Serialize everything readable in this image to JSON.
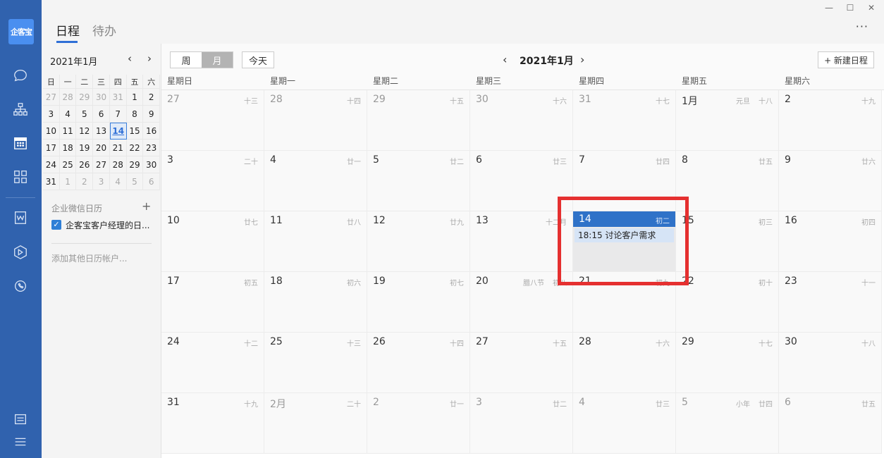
{
  "app": {
    "logo": "企客宝"
  },
  "tabs": {
    "schedule": "日程",
    "todo": "待办"
  },
  "window": {
    "minimize": "—",
    "maximize": "☐",
    "close": "✕",
    "more": "···"
  },
  "mini": {
    "title": "2021年1月",
    "prev": "‹",
    "next": "›",
    "weekdays": [
      "日",
      "一",
      "二",
      "三",
      "四",
      "五",
      "六"
    ],
    "weeks": [
      [
        "27",
        "28",
        "29",
        "30",
        "31",
        "1",
        "2"
      ],
      [
        "3",
        "4",
        "5",
        "6",
        "7",
        "8",
        "9"
      ],
      [
        "10",
        "11",
        "12",
        "13",
        "14",
        "15",
        "16"
      ],
      [
        "17",
        "18",
        "19",
        "20",
        "21",
        "22",
        "23"
      ],
      [
        "24",
        "25",
        "26",
        "27",
        "28",
        "29",
        "30"
      ],
      [
        "31",
        "1",
        "2",
        "3",
        "4",
        "5",
        "6"
      ]
    ],
    "section_label": "企业微信日历",
    "section_add": "+",
    "calendar_name": "企客宝客户经理的日...",
    "add_account": "添加其他日历帐户..."
  },
  "toolbar": {
    "week": "周",
    "month": "月",
    "today": "今天",
    "prev": "‹",
    "title": "2021年1月",
    "next": "›",
    "new_event": "+ 新建日程"
  },
  "weekdays": [
    "星期日",
    "星期一",
    "星期二",
    "星期三",
    "星期四",
    "星期五",
    "星期六"
  ],
  "month_grid": [
    [
      {
        "d": "27",
        "l": "十三",
        "o": 1
      },
      {
        "d": "28",
        "l": "十四",
        "o": 1
      },
      {
        "d": "29",
        "l": "十五",
        "o": 1
      },
      {
        "d": "30",
        "l": "十六",
        "o": 1
      },
      {
        "d": "31",
        "l": "十七",
        "o": 1
      },
      {
        "d": "1月",
        "l": "十八",
        "f": "元旦"
      },
      {
        "d": "2",
        "l": "十九"
      }
    ],
    [
      {
        "d": "3",
        "l": "二十"
      },
      {
        "d": "4",
        "l": "廿一"
      },
      {
        "d": "5",
        "l": "廿二"
      },
      {
        "d": "6",
        "l": "廿三"
      },
      {
        "d": "7",
        "l": "廿四"
      },
      {
        "d": "8",
        "l": "廿五"
      },
      {
        "d": "9",
        "l": "廿六"
      }
    ],
    [
      {
        "d": "10",
        "l": "廿七"
      },
      {
        "d": "11",
        "l": "廿八"
      },
      {
        "d": "12",
        "l": "廿九"
      },
      {
        "d": "13",
        "l": "十二月"
      },
      {
        "d": "14",
        "l": "初二",
        "sel": 1
      },
      {
        "d": "15",
        "l": "初三"
      },
      {
        "d": "16",
        "l": "初四"
      }
    ],
    [
      {
        "d": "17",
        "l": "初五"
      },
      {
        "d": "18",
        "l": "初六"
      },
      {
        "d": "19",
        "l": "初七"
      },
      {
        "d": "20",
        "l": "初八",
        "f": "腊八节"
      },
      {
        "d": "21",
        "l": "初九"
      },
      {
        "d": "22",
        "l": "初十"
      },
      {
        "d": "23",
        "l": "十一"
      }
    ],
    [
      {
        "d": "24",
        "l": "十二"
      },
      {
        "d": "25",
        "l": "十三"
      },
      {
        "d": "26",
        "l": "十四"
      },
      {
        "d": "27",
        "l": "十五"
      },
      {
        "d": "28",
        "l": "十六"
      },
      {
        "d": "29",
        "l": "十七"
      },
      {
        "d": "30",
        "l": "十八"
      }
    ],
    [
      {
        "d": "31",
        "l": "十九"
      },
      {
        "d": "2月",
        "l": "二十",
        "o": 1
      },
      {
        "d": "2",
        "l": "廿一",
        "o": 1
      },
      {
        "d": "3",
        "l": "廿二",
        "o": 1
      },
      {
        "d": "4",
        "l": "廿三",
        "o": 1
      },
      {
        "d": "5",
        "l": "廿四",
        "o": 1,
        "f": "小年"
      },
      {
        "d": "6",
        "l": "廿五",
        "o": 1
      }
    ]
  ],
  "event": {
    "text": "18:15 讨论客户需求"
  }
}
